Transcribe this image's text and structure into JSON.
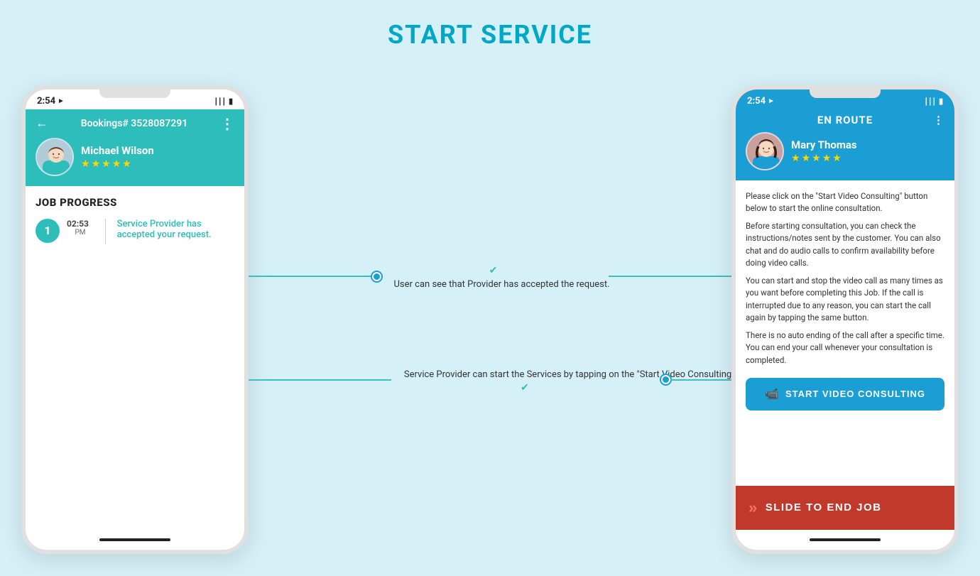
{
  "page": {
    "title": "START SERVICE",
    "background": "#d6f0f7"
  },
  "phone1": {
    "status_bar": {
      "time": "2:54",
      "location_icon": "▸",
      "wifi_icon": "WiFi",
      "battery_icon": "🔋"
    },
    "header": {
      "booking_number": "Bookings# 3528087291",
      "back_icon": "←",
      "more_icon": "⋮"
    },
    "profile": {
      "name": "Michael Wilson",
      "stars": 5
    },
    "job_progress": {
      "title": "JOB PROGRESS",
      "step": {
        "number": "1",
        "time": "02:53",
        "period": "PM",
        "text": "Service Provider has accepted your request."
      }
    }
  },
  "phone2": {
    "status_bar": {
      "time": "2:54",
      "location_icon": "▸"
    },
    "header": {
      "title": "EN ROUTE",
      "more_icon": "⋮"
    },
    "profile": {
      "name": "Mary Thomas",
      "stars": 5
    },
    "body": {
      "paragraph1": "Please click on the \"Start Video Consulting\" button below to start the online consultation.",
      "paragraph2": "Before starting consultation, you can check the instructions/notes sent by the customer. You can also chat and do audio calls to confirm availability before doing video calls.",
      "paragraph3": "You can start and stop the video call as many times as you want before completing this Job. If the call is interrupted due to any reason, you can start the call again by tapping the same button.",
      "paragraph4": "There is no auto ending of the call after a specific time. You can end your call whenever your consultation is completed."
    },
    "start_video_btn": "START VIDEO CONSULTING",
    "slide_to_end": "SLIDE TO END JOB"
  },
  "annotations": {
    "annotation1": {
      "check_icon": "✔",
      "text": "User can see that Provider has accepted the request."
    },
    "annotation2": {
      "check_icon": "✔",
      "text": "Service Provider can start the Services by tapping on the \"Start Video Consulting\"."
    }
  }
}
